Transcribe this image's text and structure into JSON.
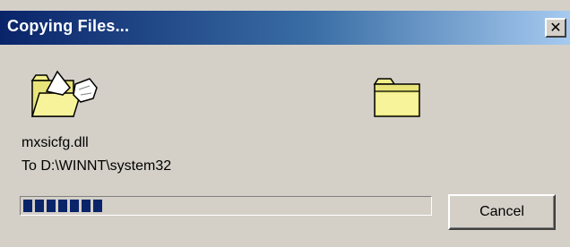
{
  "window": {
    "title": "Copying Files...",
    "close_glyph": "✕"
  },
  "icons": {
    "source": "folder-with-flying-paper-icon",
    "destination": "folder-icon"
  },
  "copy": {
    "filename": "mxsicfg.dll",
    "destination": "To D:\\WINNT\\system32"
  },
  "progress": {
    "fraction": 0.2
  },
  "buttons": {
    "cancel_label": "Cancel"
  },
  "colors": {
    "title_gradient_start": "#0a246a",
    "title_gradient_end": "#a6caf0",
    "dialog_face": "#d4d0c8",
    "progress_block": "#0a246a",
    "folder_yellow": "#f2ef88"
  }
}
